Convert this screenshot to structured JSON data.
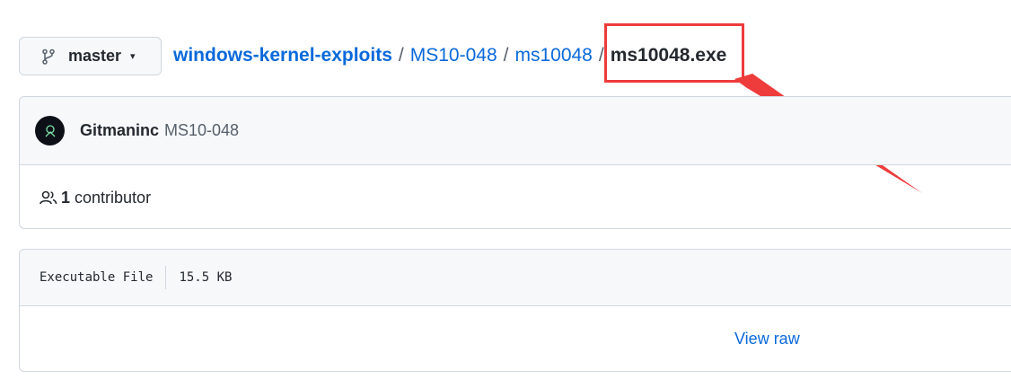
{
  "branch": {
    "name": "master",
    "icon": "git-branch-icon",
    "caret": "▾"
  },
  "breadcrumb": {
    "repo": "windows-kernel-exploits",
    "folder1": "MS10-048",
    "folder2": "ms10048",
    "separator": "/",
    "current_file": "ms10048.exe"
  },
  "annotation": {
    "highlight_color": "#ee3b3b"
  },
  "commit": {
    "author": "Gitmaninc",
    "message": "MS10-048"
  },
  "contributors": {
    "count": "1",
    "label": "contributor"
  },
  "file": {
    "type": "Executable File",
    "size": "15.5 KB",
    "view_raw_label": "View raw"
  },
  "colors": {
    "link": "#0969da",
    "border": "#d0d7de",
    "header_bg": "#f6f8fa"
  }
}
